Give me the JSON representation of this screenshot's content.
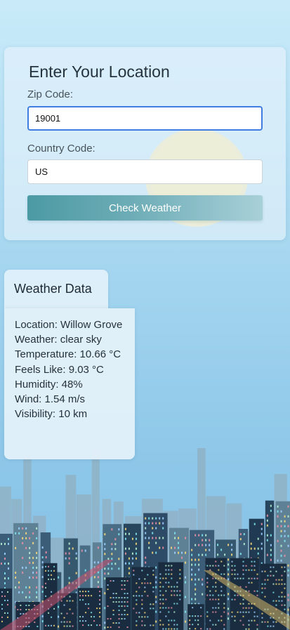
{
  "form": {
    "title": "Enter Your Location",
    "zip_label": "Zip Code:",
    "zip_value": "19001",
    "country_label": "Country Code:",
    "country_value": "US",
    "button_label": "Check Weather"
  },
  "weather": {
    "title": "Weather Data",
    "location": "Location: Willow Grove",
    "conditions": "Weather: clear sky",
    "temperature": "Temperature: 10.66 °C",
    "feels_like": "Feels Like: 9.03 °C",
    "humidity": "Humidity: 48%",
    "wind": "Wind: 1.54 m/s",
    "visibility": "Visibility: 10 km"
  },
  "colors": {
    "sun": "#ffe58f",
    "button_start": "#4c9aa4",
    "focus_ring": "#3f7de2"
  }
}
